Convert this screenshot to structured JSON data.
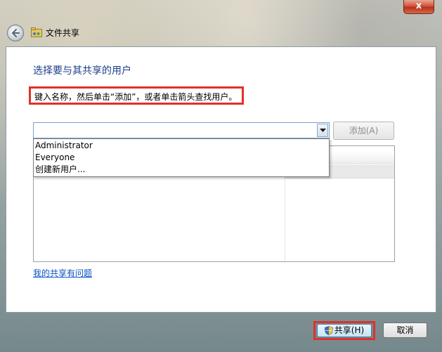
{
  "window": {
    "title": "文件共享",
    "close_glyph": "x"
  },
  "main": {
    "heading": "选择要与其共享的用户",
    "instruction": "键入名称，然后单击“添加”，或者单击箭头查找用户。",
    "combo": {
      "value": "",
      "placeholder": ""
    },
    "add_button_label": "添加(A)",
    "dropdown_items": [
      "Administrator",
      "Everyone",
      "创建新用户..."
    ],
    "help_link": "我的共享有问题"
  },
  "footer": {
    "share_label": "共享(H)",
    "cancel_label": "取消"
  },
  "colors": {
    "heading": "#1e3f8a",
    "highlight_box": "#e0312a",
    "link": "#0a52c4"
  }
}
